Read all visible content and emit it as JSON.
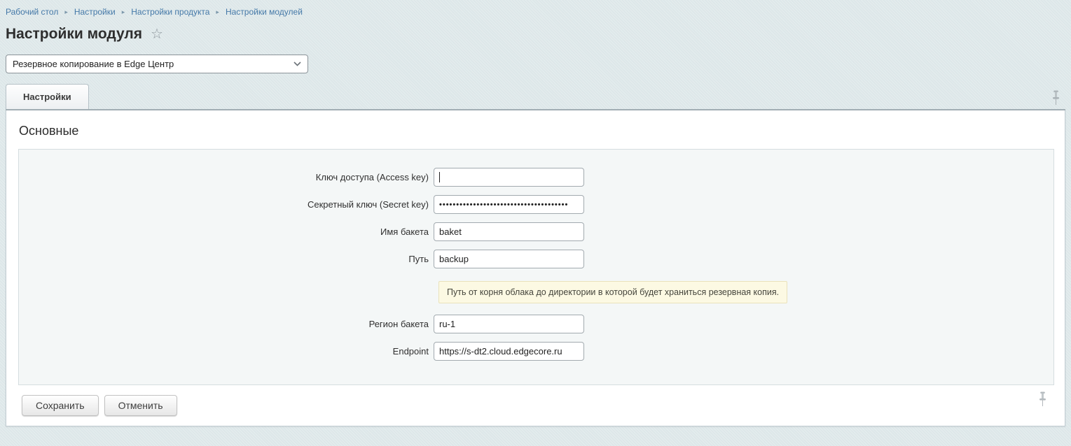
{
  "colors": {
    "page_background": "#dde7e9",
    "panel_background": "#ffffff",
    "form_background": "#f4f7f7",
    "link_blue": "#4579a8",
    "hint_background": "#fcf9e3",
    "hint_border": "#e9e2bb"
  },
  "icons": {
    "star": "☆",
    "breadcrumb_separator": "▸",
    "select_chevron": "chevron-down",
    "pin": "pushpin"
  },
  "breadcrumb": {
    "items": [
      {
        "label": "Рабочий стол"
      },
      {
        "label": "Настройки"
      },
      {
        "label": "Настройки продукта"
      },
      {
        "label": "Настройки модулей"
      }
    ]
  },
  "page": {
    "title": "Настройки модуля"
  },
  "module_select": {
    "value": "Резервное копирование в Edge Центр"
  },
  "tabs": [
    {
      "label": "Настройки",
      "active": true
    }
  ],
  "section": {
    "heading": "Основные"
  },
  "form": {
    "fields": [
      {
        "label": "Ключ доступа (Access key)",
        "value": "",
        "type": "text",
        "focused": true
      },
      {
        "label": "Секретный ключ (Secret key)",
        "value": "••••••••••••••••••••••••••••••••••••••",
        "type": "password"
      },
      {
        "label": "Имя бакета",
        "value": "baket",
        "type": "text"
      },
      {
        "label": "Путь",
        "value": "backup",
        "type": "text"
      },
      {
        "label": "Регион бакета",
        "value": "ru-1",
        "type": "text"
      },
      {
        "label": "Endpoint",
        "value": "https://s-dt2.cloud.edgecore.ru",
        "type": "text"
      }
    ],
    "hint": "Путь от корня облака до директории в которой будет храниться резервная копия."
  },
  "buttons": {
    "save": "Сохранить",
    "cancel": "Отменить"
  }
}
